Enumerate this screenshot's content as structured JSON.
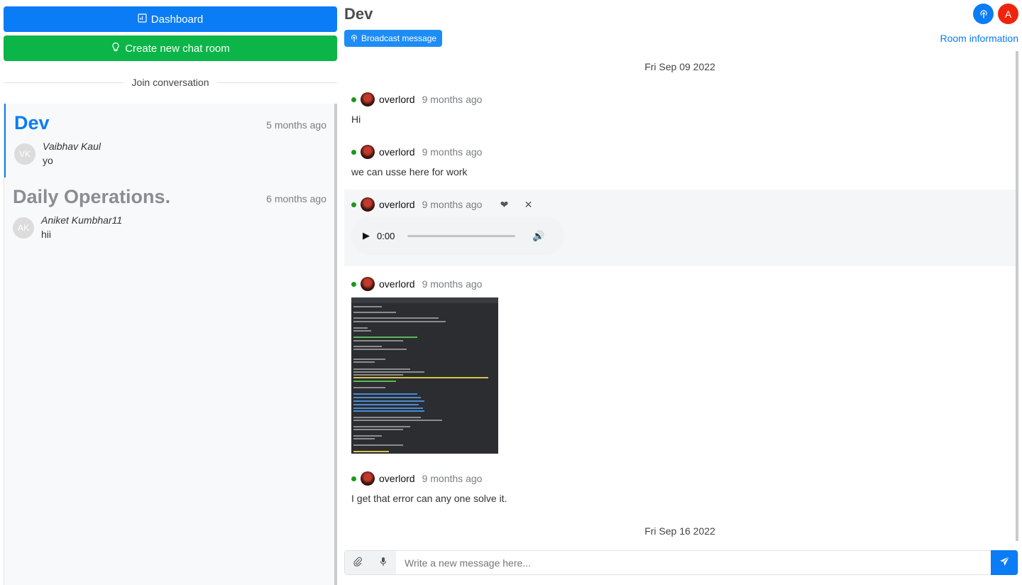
{
  "sidebar": {
    "dashboard_label": "Dashboard",
    "create_label": "Create new chat room",
    "join_label": "Join conversation",
    "rooms": [
      {
        "name": "Dev",
        "time": "5 months ago",
        "initials": "VK",
        "author": "Vaibhav Kaul",
        "last": "yo"
      },
      {
        "name": "Daily Operations.",
        "time": "6 months ago",
        "initials": "AK",
        "author": "Aniket Kumbhar11",
        "last": "hii"
      }
    ]
  },
  "header": {
    "title": "Dev",
    "broadcast_label": "Broadcast message",
    "room_info_label": "Room information",
    "user_initial": "A"
  },
  "chat": {
    "dates": [
      "Fri Sep 09 2022",
      "Fri Sep 16 2022"
    ],
    "messages": [
      {
        "user": "overlord",
        "time": "9 months ago",
        "text": "Hi"
      },
      {
        "user": "overlord",
        "time": "9 months ago",
        "text": "we can usse here for work"
      },
      {
        "user": "overlord",
        "time": "9 months ago",
        "audio_time": "0:00"
      },
      {
        "user": "overlord",
        "time": "9 months ago"
      },
      {
        "user": "overlord",
        "time": "9 months ago",
        "text": "I get that error can any one solve it."
      }
    ]
  },
  "composer": {
    "placeholder": "Write a new message here..."
  },
  "colors": {
    "primary": "#0a7cf5",
    "success": "#0bb547",
    "danger": "#f0240d",
    "online": "#1a9a1a"
  }
}
